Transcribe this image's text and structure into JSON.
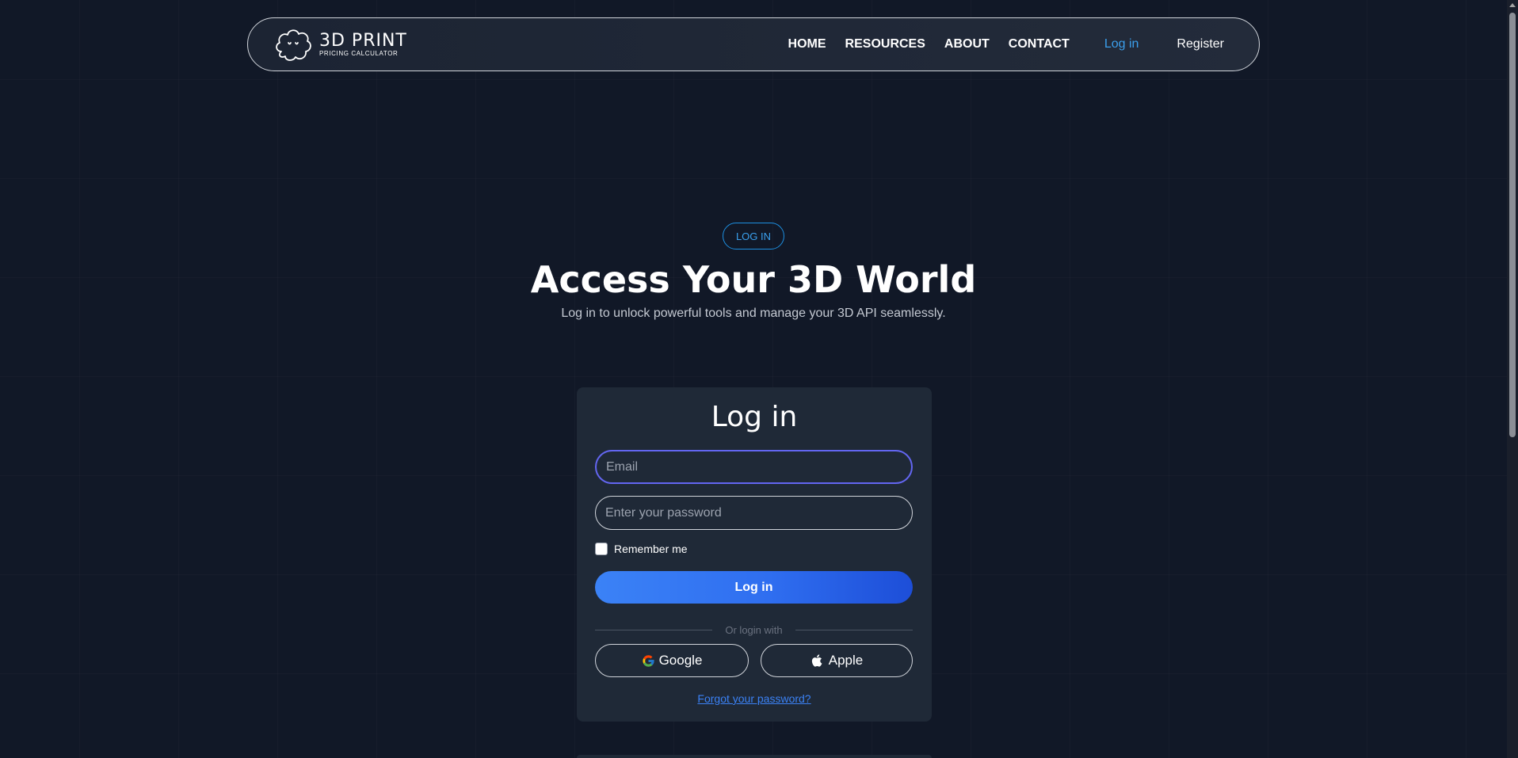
{
  "header": {
    "logo": {
      "title": "3D PRINT",
      "subtitle": "PRICING CALCULATOR",
      "icon": "cloud-face-icon"
    },
    "nav": [
      {
        "label": "HOME"
      },
      {
        "label": "RESOURCES"
      },
      {
        "label": "ABOUT"
      },
      {
        "label": "CONTACT"
      }
    ],
    "login_label": "Log in",
    "register_label": "Register"
  },
  "hero": {
    "badge": "LOG IN",
    "title": "Access Your 3D World",
    "subtitle": "Log in to unlock powerful tools and manage your 3D API seamlessly."
  },
  "login_form": {
    "title": "Log in",
    "email": {
      "placeholder": "Email",
      "value": ""
    },
    "password": {
      "placeholder": "Enter your password",
      "value": ""
    },
    "remember_label": "Remember me",
    "remember_checked": false,
    "submit_label": "Log in",
    "divider_text": "Or login with",
    "social": [
      {
        "label": "Google",
        "icon": "google-icon"
      },
      {
        "label": "Apple",
        "icon": "apple-icon"
      }
    ],
    "forgot_label": "Forgot your password?"
  },
  "colors": {
    "background": "#111827",
    "card": "#1f2937",
    "accent": "#3b9fec",
    "button_start": "#3b82f6",
    "button_end": "#1d4ed8",
    "focus_border": "#6366f1"
  }
}
